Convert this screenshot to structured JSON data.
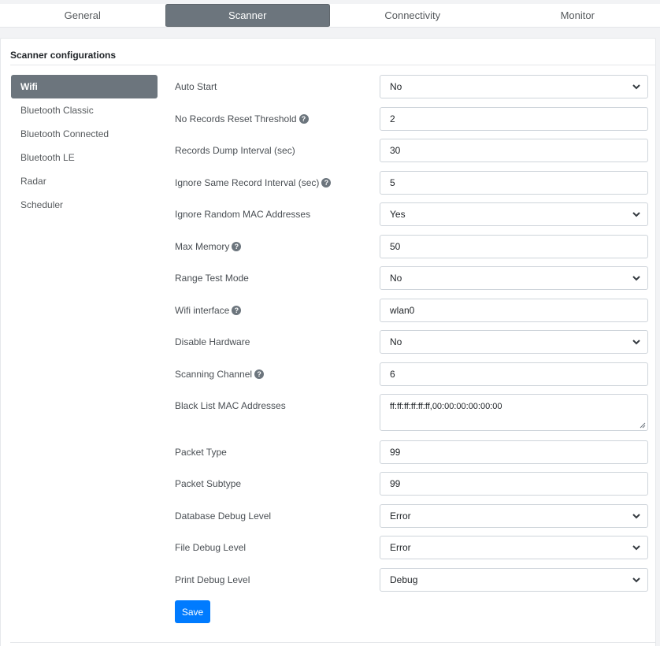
{
  "tabs": [
    "General",
    "Scanner",
    "Connectivity",
    "Monitor"
  ],
  "card_title": "Scanner configurations",
  "subnav": [
    "Wifi",
    "Bluetooth Classic",
    "Bluetooth Connected",
    "Bluetooth LE",
    "Radar",
    "Scheduler"
  ],
  "fields": {
    "auto_start": {
      "label": "Auto Start",
      "value": "No"
    },
    "no_records_reset": {
      "label": "No Records Reset Threshold",
      "value": "2"
    },
    "records_dump": {
      "label": "Records Dump Interval (sec)",
      "value": "30"
    },
    "ignore_same": {
      "label": "Ignore Same Record Interval (sec)",
      "value": "5"
    },
    "ignore_random_mac": {
      "label": "Ignore Random MAC Addresses",
      "value": "Yes"
    },
    "max_memory": {
      "label": "Max Memory",
      "value": "50"
    },
    "range_test": {
      "label": "Range Test Mode",
      "value": "No"
    },
    "wifi_interface": {
      "label": "Wifi interface",
      "value": "wlan0"
    },
    "disable_hardware": {
      "label": "Disable Hardware",
      "value": "No"
    },
    "scanning_channel": {
      "label": "Scanning Channel",
      "value": "6"
    },
    "blacklist_mac": {
      "label": "Black List MAC Addresses",
      "value": "ff:ff:ff:ff:ff:ff,00:00:00:00:00:00"
    },
    "packet_type": {
      "label": "Packet Type",
      "value": "99"
    },
    "packet_subtype": {
      "label": "Packet Subtype",
      "value": "99"
    },
    "db_debug": {
      "label": "Database Debug Level",
      "value": "Error"
    },
    "file_debug": {
      "label": "File Debug Level",
      "value": "Error"
    },
    "print_debug": {
      "label": "Print Debug Level",
      "value": "Debug"
    }
  },
  "help_glyph": "?",
  "save_label": "Save",
  "colors": {
    "active_tab": "#6c757d",
    "primary": "#007bff"
  }
}
